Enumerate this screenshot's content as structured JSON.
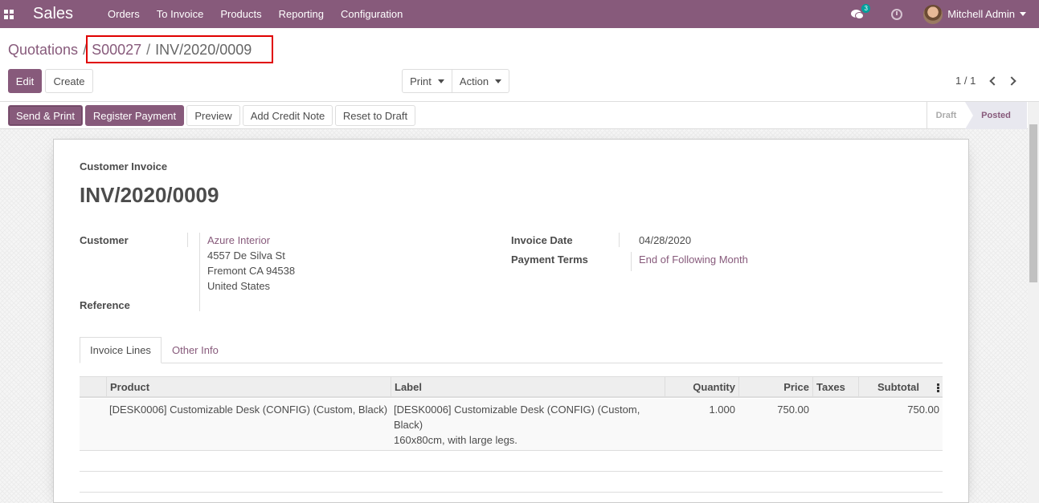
{
  "navbar": {
    "brand": "Sales",
    "menu": [
      "Orders",
      "To Invoice",
      "Products",
      "Reporting",
      "Configuration"
    ],
    "message_count": "3",
    "user_name": "Mitchell Admin"
  },
  "breadcrumb": {
    "root": "Quotations",
    "parent": "S00027",
    "current": "INV/2020/0009"
  },
  "toolbar": {
    "edit_label": "Edit",
    "create_label": "Create",
    "print_label": "Print",
    "action_label": "Action",
    "pager": "1 / 1"
  },
  "statusbar": {
    "send_print_label": "Send & Print",
    "register_payment_label": "Register Payment",
    "preview_label": "Preview",
    "add_credit_note_label": "Add Credit Note",
    "reset_to_draft_label": "Reset to Draft",
    "stages": [
      "Draft",
      "Posted"
    ],
    "active_stage": "Posted"
  },
  "invoice": {
    "type_label": "Customer Invoice",
    "number": "INV/2020/0009",
    "customer_label": "Customer",
    "customer_name": "Azure Interior",
    "address_line1": "4557 De Silva St",
    "address_line2": "Fremont CA 94538",
    "address_line3": "United States",
    "reference_label": "Reference",
    "invoice_date_label": "Invoice Date",
    "invoice_date": "04/28/2020",
    "payment_terms_label": "Payment Terms",
    "payment_terms": "End of Following Month"
  },
  "tabs": [
    {
      "label": "Invoice Lines",
      "active": true
    },
    {
      "label": "Other Info",
      "active": false
    }
  ],
  "lines_table": {
    "columns": [
      "Product",
      "Label",
      "Quantity",
      "Price",
      "Taxes",
      "Subtotal"
    ],
    "rows": [
      {
        "product": "[DESK0006] Customizable Desk (CONFIG) (Custom, Black)",
        "label_line1": "[DESK0006] Customizable Desk (CONFIG) (Custom,",
        "label_line2": "Black)",
        "label_line3": "160x80cm, with large legs.",
        "quantity": "1.000",
        "price": "750.00",
        "taxes": "",
        "subtotal": "750.00"
      }
    ]
  },
  "colors": {
    "brand": "#875a7b",
    "badge": "#00a09d",
    "highlight": "#e00000"
  }
}
